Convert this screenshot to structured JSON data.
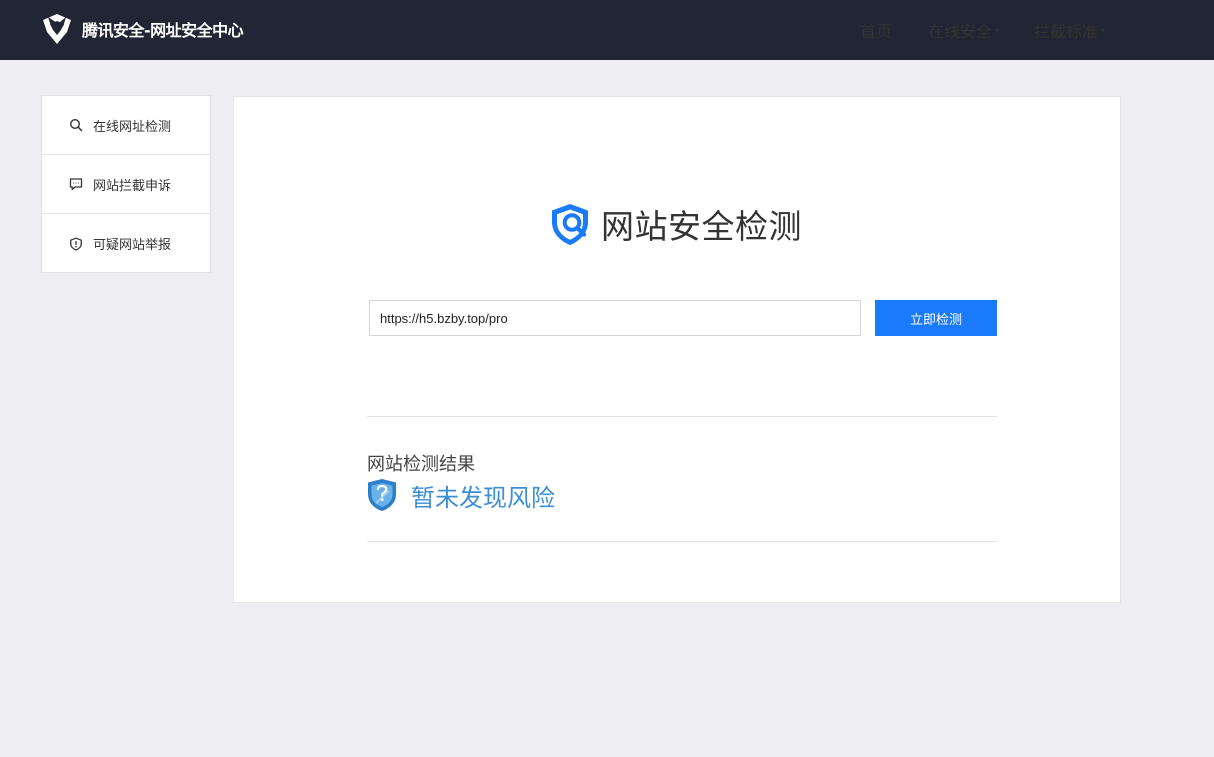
{
  "header": {
    "logo_icon": "tencent-shield-logo",
    "title": "腾讯安全-网址安全中心",
    "nav": [
      {
        "label": "首页",
        "has_dropdown": false
      },
      {
        "label": "在线安全",
        "has_dropdown": true
      },
      {
        "label": "拦截标准",
        "has_dropdown": true
      }
    ],
    "dropdown_caret": "▾"
  },
  "sidebar": {
    "items": [
      {
        "label": "在线网址检测",
        "icon": "search-icon"
      },
      {
        "label": "网站拦截申诉",
        "icon": "chat-bubble-icon"
      },
      {
        "label": "可疑网站举报",
        "icon": "shield-alert-icon"
      }
    ]
  },
  "main": {
    "title": "网站安全检测",
    "title_icon": "shield-search-icon",
    "url_input": {
      "value": "https://h5.bzby.top/pro"
    },
    "check_button": "立即检测",
    "result": {
      "label": "网站检测结果",
      "status": "暂未发现风险",
      "status_icon": "question-shield-icon"
    }
  },
  "colors": {
    "topbar": "#222533",
    "background": "#eeeef2",
    "accent_blue": "#1a7afc",
    "result_blue": "#3c8ed6"
  }
}
